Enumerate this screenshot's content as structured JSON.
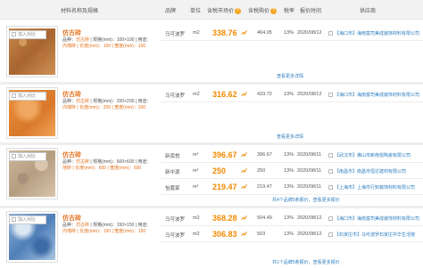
{
  "header": {
    "material": "材料名称及规格",
    "brand": "品牌",
    "unit": "单位",
    "market_price": "含税市场价",
    "purchase_price": "含税购价",
    "tax_rate": "税率",
    "report_time": "报价时间",
    "supplier": "供应商",
    "help_glyph": "?"
  },
  "add_compare_label": "加入对比",
  "products": [
    {
      "name": "仿古砖",
      "variety_label": "品种：",
      "variety": "仿古砖",
      "spec_label": "| 规格(mm)：",
      "spec": "100×100",
      "usage_label": "| 用途：",
      "dims": "内墙砖 | 长度(mm)：100 | 宽度(mm)：100",
      "texture": "tex-a",
      "offers": [
        {
          "brand": "马可波罗",
          "unit": "m2",
          "market_price": "338.76",
          "purchase_price": "464.05",
          "tax_rate": "13%",
          "date": "2020/08/12",
          "supplier": "【海口市】海南富司美成装饰材料有限公司"
        }
      ],
      "footer": "查看更多详情"
    },
    {
      "name": "仿古砖",
      "variety_label": "品种：",
      "variety": "仿古砖",
      "spec_label": "| 规格(mm)：",
      "spec": "200×200",
      "usage_label": "| 用途：",
      "dims": "内墙砖 | 长度(mm)：200 | 宽度(mm)：200",
      "texture": "tex-b",
      "offers": [
        {
          "brand": "马可波罗",
          "unit": "m2",
          "market_price": "316.62",
          "purchase_price": "433.72",
          "tax_rate": "13%",
          "date": "2020/08/12",
          "supplier": "【海口市】海南富司美成装饰材料有限公司"
        }
      ],
      "footer": "查看更多详情"
    },
    {
      "name": "仿古砖",
      "variety_label": "品种：",
      "variety": "仿古砖",
      "spec_label": "| 规格(mm)：",
      "spec": "600×600",
      "usage_label": "| 用途：",
      "dims": "地砖 | 长度(mm)：600 | 宽度(mm)：600",
      "texture": "tex-c",
      "offers": [
        {
          "brand": "新南悦",
          "unit": "m²",
          "market_price": "396.67",
          "purchase_price": "396.67",
          "tax_rate": "13%",
          "date": "2020/08/11",
          "supplier": "【武汉市】佛山市新南悦陶瓷有限公司"
        },
        {
          "brand": "新中源",
          "unit": "m²",
          "market_price": "250",
          "purchase_price": "250",
          "tax_rate": "13%",
          "date": "2020/08/11",
          "supplier": "【南昌市】南昌市恒达建材有限公司"
        },
        {
          "brand": "怡嘉家",
          "unit": "m²",
          "market_price": "219.47",
          "purchase_price": "219.47",
          "tax_rate": "13%",
          "date": "2020/08/11",
          "supplier": "【上海市】上海市行知装饰材料有限公司"
        }
      ],
      "footer": "共4个品牌5条报价，查看更多报价"
    },
    {
      "name": "仿古砖",
      "variety_label": "品种：",
      "variety": "仿古砖",
      "spec_label": "| 规格(mm)：",
      "spec": "150×150",
      "usage_label": "| 用途：",
      "dims": "内墙砖 | 长度(mm)：150 | 宽度(mm)：150",
      "texture": "tex-d",
      "offers": [
        {
          "brand": "马可波罗",
          "unit": "m2",
          "market_price": "368.28",
          "purchase_price": "504.49",
          "tax_rate": "13%",
          "date": "2020/08/12",
          "supplier": "【海口市】海南富司美成装饰材料有限公司"
        },
        {
          "brand": "马可波罗",
          "unit": "m2",
          "market_price": "306.83",
          "purchase_price": "503",
          "tax_rate": "13%",
          "date": "2020/08/12",
          "supplier": "【石家庄市】马可波罗石家庄中华生活馆"
        }
      ],
      "footer": "共1个品牌5条报价，查看更多报价"
    }
  ],
  "colors": {
    "accent": "#f08a00",
    "link": "#2d7dbf",
    "title": "#e4731f",
    "help": "#f5a623"
  }
}
